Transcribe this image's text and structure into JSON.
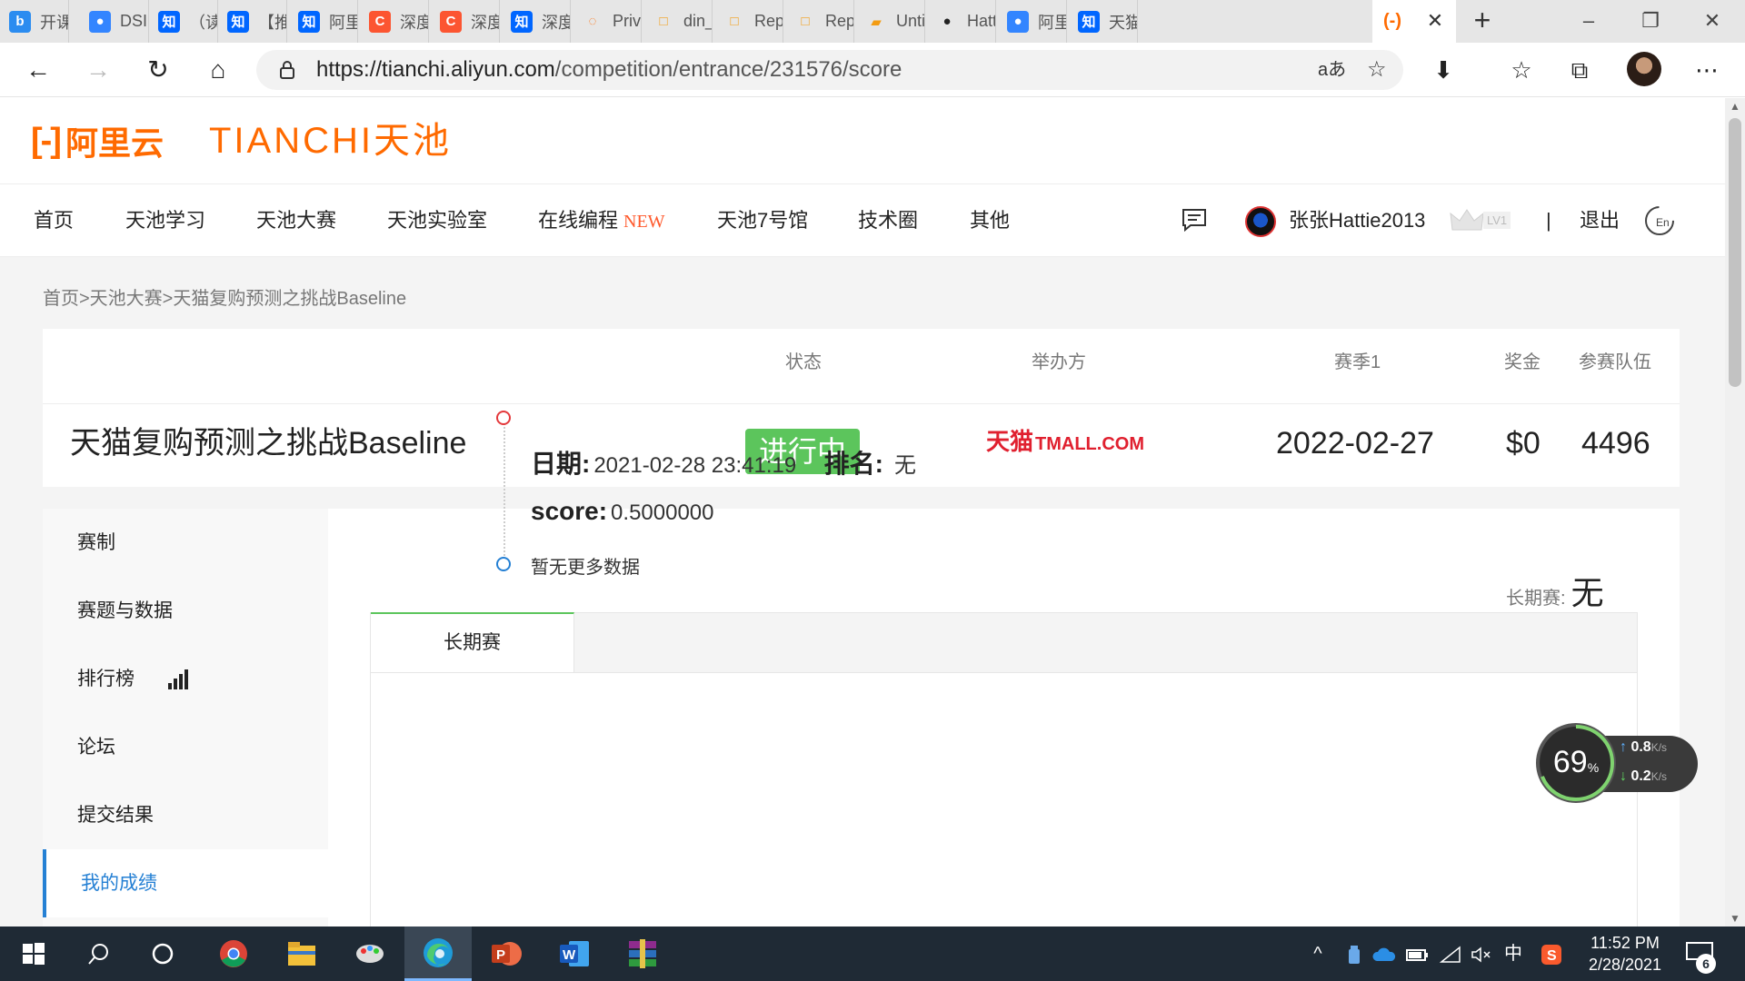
{
  "browser": {
    "tabs": [
      {
        "label": "开课",
        "icon": "bing-icon",
        "color": "#2b8cf0"
      },
      {
        "label": "DSIN",
        "icon": "baidu-icon",
        "color": "#3385ff"
      },
      {
        "label": "（读",
        "icon": "zhihu-icon",
        "color": "#0066ff"
      },
      {
        "label": "【推荐",
        "icon": "zhihu-icon",
        "color": "#0066ff"
      },
      {
        "label": "阿里",
        "icon": "zhihu-icon",
        "color": "#0066ff"
      },
      {
        "label": "深度",
        "icon": "csdn-icon",
        "color": "#fc5531"
      },
      {
        "label": "深度",
        "icon": "csdn-icon",
        "color": "#fc5531"
      },
      {
        "label": "深度",
        "icon": "zhihu-icon",
        "color": "#0066ff"
      },
      {
        "label": "Priva",
        "icon": "loading-icon",
        "color": "#ff6a00"
      },
      {
        "label": "din_s",
        "icon": "document-icon",
        "color": "#f39c12"
      },
      {
        "label": "Repe",
        "icon": "document-icon",
        "color": "#f39c12"
      },
      {
        "label": "Repe",
        "icon": "document-icon",
        "color": "#f39c12"
      },
      {
        "label": "Untit",
        "icon": "book-icon",
        "color": "#f39c12"
      },
      {
        "label": "Hatt",
        "icon": "github-icon",
        "color": "#222222"
      },
      {
        "label": "阿里",
        "icon": "baidu-icon",
        "color": "#3385ff"
      },
      {
        "label": "天猫",
        "icon": "zhihu-icon",
        "color": "#0066ff"
      }
    ],
    "url": {
      "host": "https://tianchi.aliyun.com",
      "path": "/competition/entrance/231576/score"
    },
    "read_aloud": "aあ"
  },
  "site": {
    "logo_aliyun": "阿里云",
    "logo_tianchi": "TIANCHI天池",
    "nav": [
      {
        "label": "首页"
      },
      {
        "label": "天池学习"
      },
      {
        "label": "天池大赛"
      },
      {
        "label": "天池实验室"
      },
      {
        "label": "在线编程",
        "badge": "NEW"
      },
      {
        "label": "天池7号馆"
      },
      {
        "label": "技术圈"
      },
      {
        "label": "其他"
      }
    ],
    "user": {
      "name": "张张Hattie2013",
      "level": "LV1"
    },
    "separator": "|",
    "logout": "退出"
  },
  "breadcrumb": "首页>天池大赛>天猫复购预测之挑战Baseline",
  "competition": {
    "headers": {
      "status": "状态",
      "organizer": "举办方",
      "season": "赛季1",
      "prize": "奖金",
      "teams": "参赛队伍"
    },
    "title": "天猫复购预测之挑战Baseline",
    "status": "进行中",
    "organizer_logo": {
      "cn": "天猫",
      "en": "TMALL.COM"
    },
    "season_date": "2022-02-27",
    "prize": "$0",
    "teams": "4496",
    "status_color": "#5cc55c",
    "organizer_color": "#e0202f"
  },
  "sidebar": {
    "items": [
      {
        "label": "赛制"
      },
      {
        "label": "赛题与数据"
      },
      {
        "label": "排行榜"
      },
      {
        "label": "论坛"
      },
      {
        "label": "提交结果"
      },
      {
        "label": "我的成绩"
      }
    ],
    "active_index": 5
  },
  "score": {
    "long_term_label": "长期赛:",
    "long_term_value": "无",
    "tab": "长期赛",
    "record": {
      "date_label": "日期:",
      "date": "2021-02-28 23:41:19",
      "rank_label": "排名:",
      "rank": "无",
      "score_label": "score:",
      "score": "0.5000000"
    },
    "no_more": "暂无更多数据"
  },
  "speed_widget": {
    "percent": "69",
    "percent_unit": "%",
    "up": "0.8",
    "down": "0.2",
    "unit": "K/s",
    "up_arrow": "↑",
    "down_arrow": "↓"
  },
  "taskbar": {
    "apps": [
      {
        "name": "start-icon"
      },
      {
        "name": "search-icon"
      },
      {
        "name": "cortana-icon"
      },
      {
        "name": "chrome-icon"
      },
      {
        "name": "file-explorer-icon"
      },
      {
        "name": "paint-app-icon"
      },
      {
        "name": "edge-icon"
      },
      {
        "name": "powerpoint-icon"
      },
      {
        "name": "word-icon"
      },
      {
        "name": "winrar-icon"
      }
    ],
    "ime": "中",
    "time": "11:52 PM",
    "date": "2/28/2021",
    "notification_count": "6"
  }
}
